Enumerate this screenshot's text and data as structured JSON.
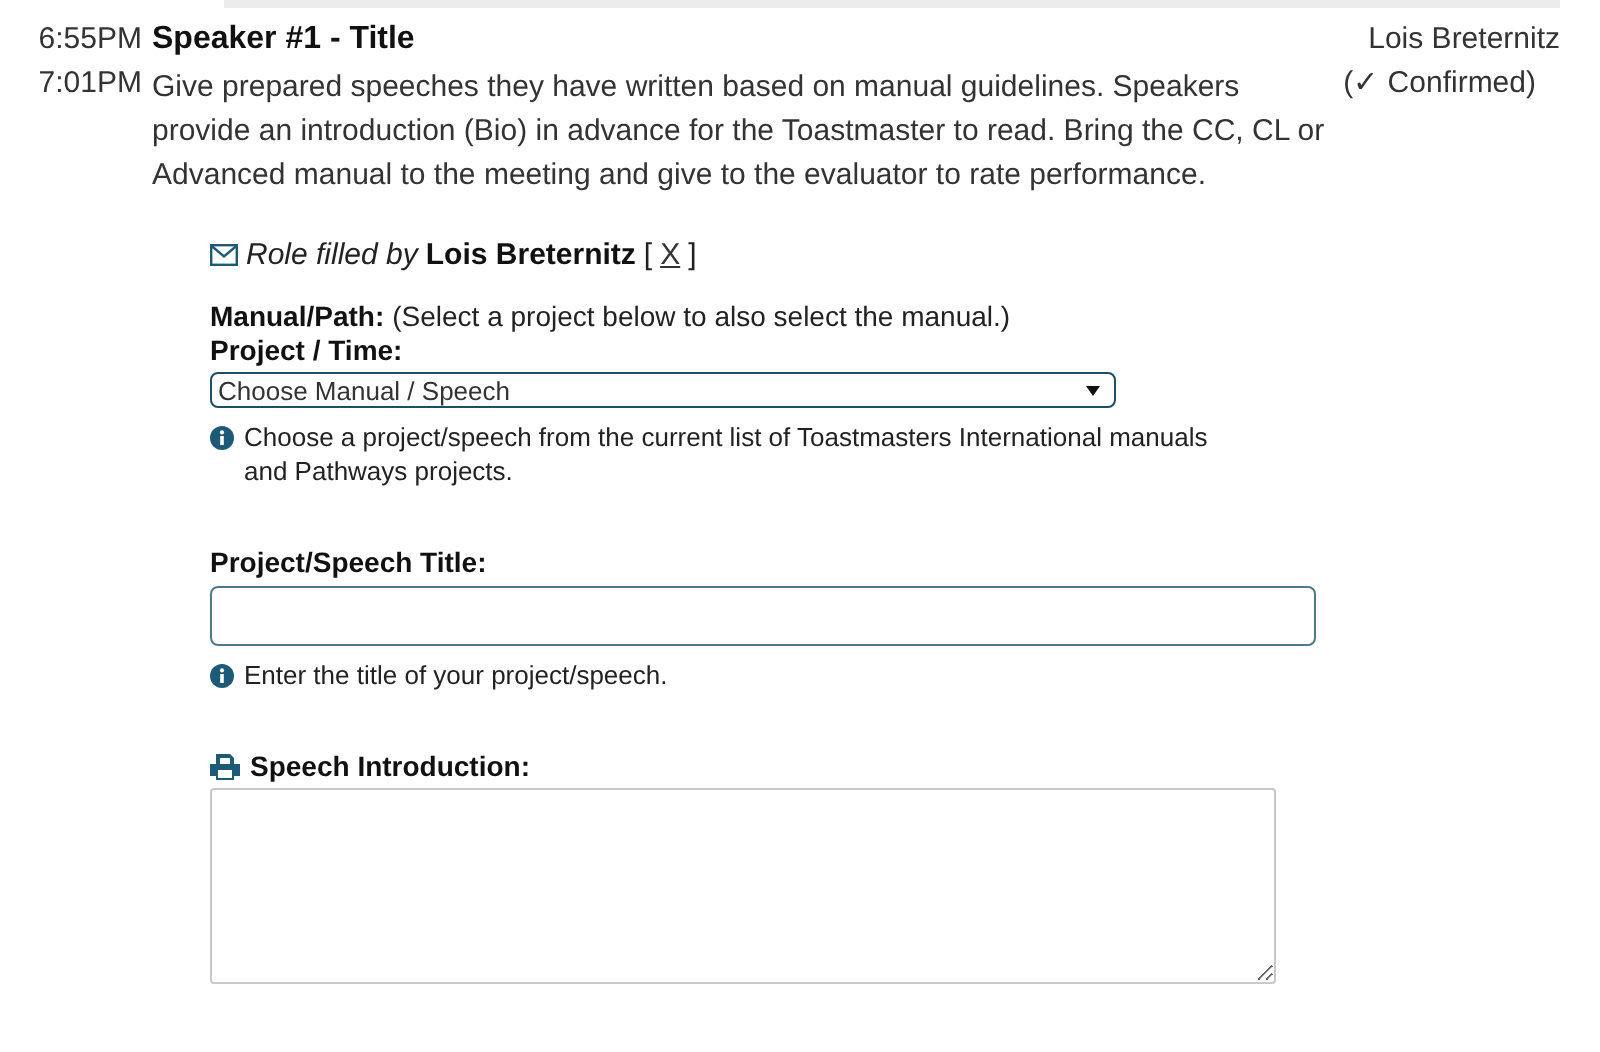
{
  "role": {
    "start_time": "6:55PM",
    "end_time": "7:01PM",
    "title": "Speaker #1 - Title",
    "description": "Give prepared speeches they have written based on manual guidelines. Speakers provide an introduction (Bio) in advance for the Toastmaster to read. Bring the CC, CL or Advanced manual to the meeting and give to the evaluator to rate performance.",
    "assignee": "Lois Breternitz",
    "status": "(✓ Confirmed)"
  },
  "filled": {
    "prefix": "Role filled by",
    "name": "Lois Breternitz",
    "bracket_open": "[",
    "remove_link": "X",
    "bracket_close": "]"
  },
  "form": {
    "manual_label": "Manual/Path:",
    "manual_hint": "(Select a project below to also select the manual.)",
    "project_label": "Project / Time:",
    "project_select": "Choose Manual / Speech",
    "project_help": "Choose a project/speech from the current list of Toastmasters International manuals and Pathways projects.",
    "title_label": "Project/Speech Title:",
    "title_help": "Enter the title of your project/speech.",
    "intro_label": "Speech Introduction:"
  }
}
